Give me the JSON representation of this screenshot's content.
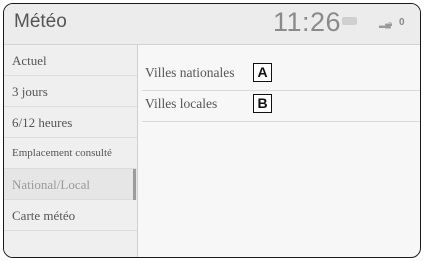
{
  "header": {
    "title": "Météo",
    "clock": "11:26",
    "status": {
      "signal_icon": "signal-icon",
      "lock_icon": "lock-icon",
      "indicator": "0"
    }
  },
  "sidebar": {
    "items": [
      {
        "label": "Actuel"
      },
      {
        "label": "3 jours"
      },
      {
        "label": "6/12 heures"
      },
      {
        "label": "Emplacement consulté"
      },
      {
        "label": "National/Local",
        "selected": true
      },
      {
        "label": "Carte météo"
      }
    ]
  },
  "main": {
    "rows": [
      {
        "label": "Villes nationales",
        "tag": "A"
      },
      {
        "label": "Villes locales",
        "tag": "B"
      }
    ]
  }
}
